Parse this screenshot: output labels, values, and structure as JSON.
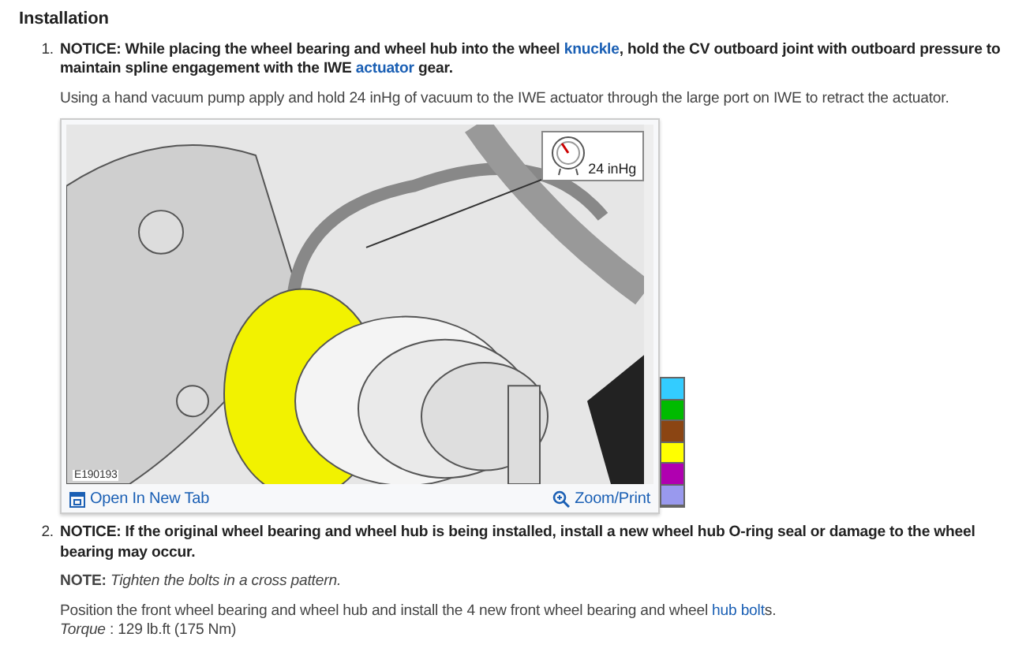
{
  "section_title": "Installation",
  "steps": [
    {
      "number": "1.",
      "blocks": [
        {
          "kind": "notice",
          "segments": [
            {
              "kind": "text",
              "text": "NOTICE: While placing the wheel bearing and wheel hub into the wheel "
            },
            {
              "kind": "link",
              "text": "knuckle"
            },
            {
              "kind": "text",
              "text": ", hold the CV outboard joint with outboard pressure to maintain spline engagement with the IWE "
            },
            {
              "kind": "link",
              "text": "actuator"
            },
            {
              "kind": "text",
              "text": " gear."
            }
          ]
        },
        {
          "kind": "text",
          "segments": [
            {
              "kind": "text",
              "text": "Using a hand vacuum pump apply and hold 24 inHg of vacuum to the IWE actuator through the large port on IWE to retract the actuator."
            }
          ]
        },
        {
          "kind": "figure",
          "figure_id": "E190193",
          "gauge_label": "24 inHg",
          "open_link": "Open In New Tab",
          "zoom_link": "Zoom/Print",
          "swatches": [
            {
              "color": "#33ccff"
            },
            {
              "color": "#00bb00"
            },
            {
              "color": "#8b4513"
            },
            {
              "color": "#ffff00"
            },
            {
              "color": "#b000b0"
            },
            {
              "color": "#9999ee"
            }
          ]
        }
      ]
    },
    {
      "number": "2.",
      "blocks": [
        {
          "kind": "notice",
          "segments": [
            {
              "kind": "text",
              "text": "NOTICE: If the original wheel bearing and wheel hub is being installed, install a new wheel hub O-ring seal or damage to the wheel bearing may occur."
            }
          ]
        },
        {
          "kind": "note",
          "rich": "**NOTE:** *Tighten the bolts in a cross pattern.*"
        },
        {
          "kind": "text",
          "segments": [
            {
              "kind": "text",
              "text": "Position the front wheel bearing and wheel hub and install the 4 new front wheel bearing and wheel "
            },
            {
              "kind": "link",
              "text": "hub bolt"
            },
            {
              "kind": "text",
              "text": "s."
            }
          ]
        },
        {
          "kind": "spec",
          "rich": "*Torque* : 129 lb.ft (175 Nm)"
        }
      ]
    }
  ]
}
